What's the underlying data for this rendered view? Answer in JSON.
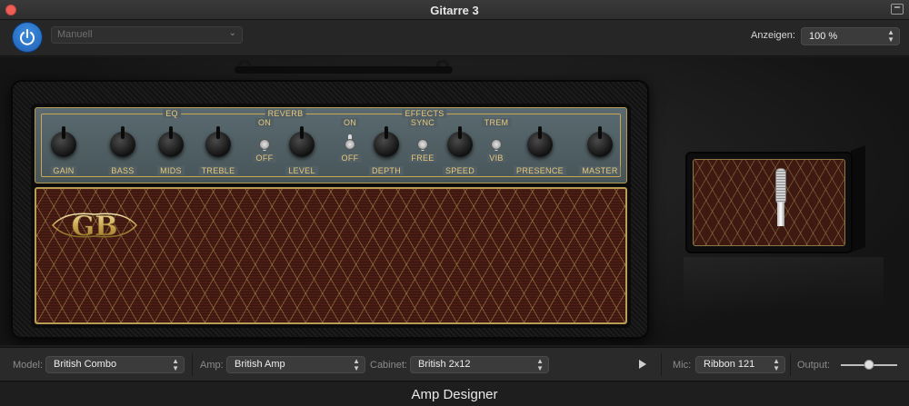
{
  "window": {
    "title": "Gitarre 3"
  },
  "header": {
    "preset": "Manuell",
    "view_label": "Anzeigen:",
    "view_value": "100 %"
  },
  "amp": {
    "section_labels": {
      "eq": "EQ",
      "reverb": "REVERB",
      "effects": "EFFECTS"
    },
    "knob_labels": [
      "GAIN",
      "BASS",
      "MIDS",
      "TREBLE",
      "LEVEL",
      "DEPTH",
      "SPEED",
      "PRESENCE",
      "MASTER"
    ],
    "switches": {
      "reverb": {
        "top": "ON",
        "bottom": "OFF"
      },
      "effects": {
        "top": "ON",
        "bottom": "OFF"
      },
      "sync": {
        "top": "SYNC",
        "bottom": "FREE"
      },
      "trem": {
        "top": "TREM",
        "bottom": "VIB"
      }
    },
    "logo": "GB"
  },
  "controls": {
    "model_label": "Model:",
    "model_value": "British Combo",
    "amp_label": "Amp:",
    "amp_value": "British Amp",
    "cabinet_label": "Cabinet:",
    "cabinet_value": "British 2x12",
    "mic_label": "Mic:",
    "mic_value": "Ribbon 121",
    "output_label": "Output:",
    "output_level": 0.5
  },
  "footer": {
    "title": "Amp Designer"
  },
  "colors": {
    "accent": "#2f74d0",
    "gold": "#e7c87a",
    "panel": "#526065",
    "grille": "#4a1d14"
  }
}
